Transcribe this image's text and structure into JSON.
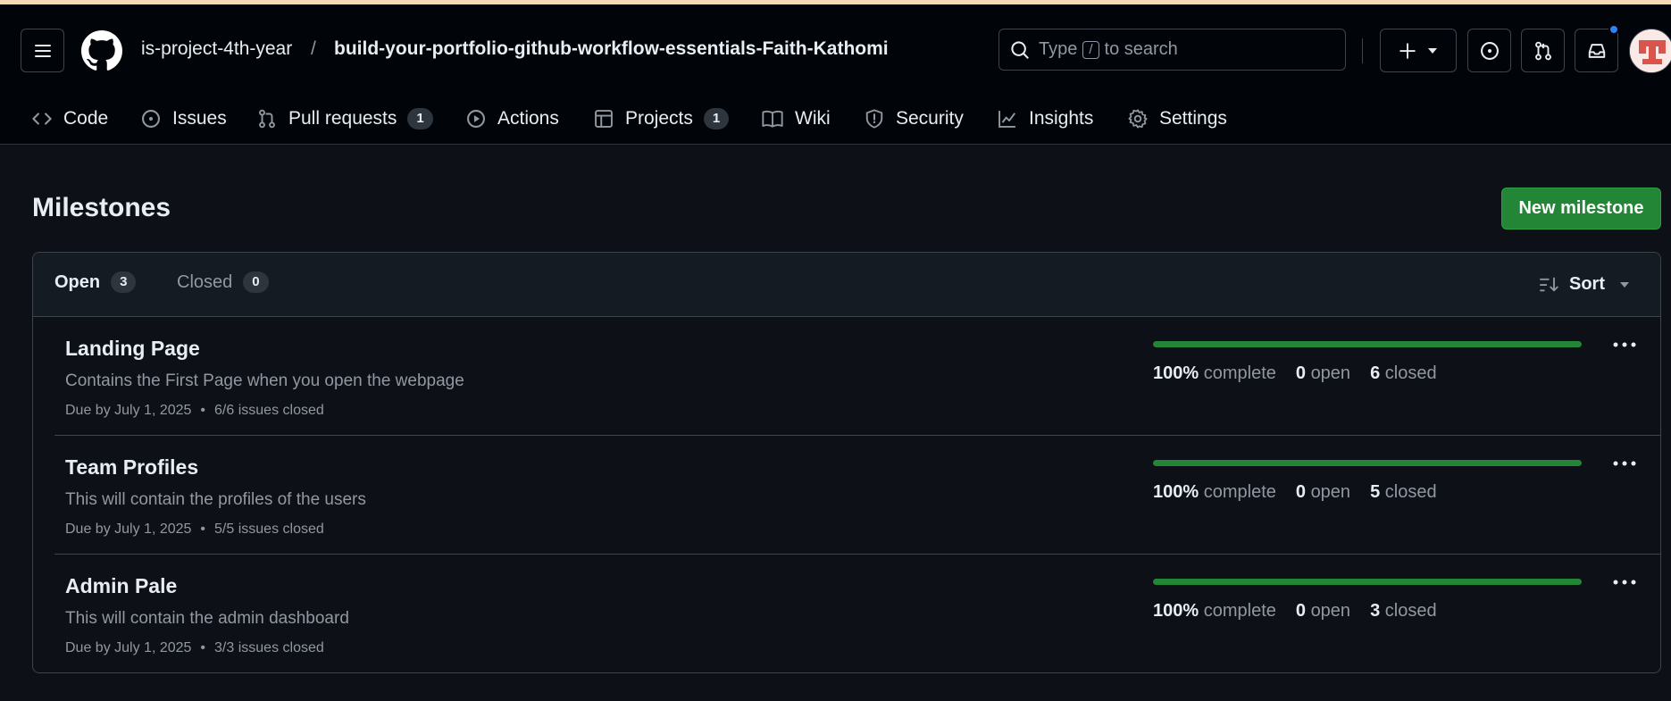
{
  "header": {
    "owner": "is-project-4th-year",
    "separator": "/",
    "repo": "build-your-portfolio-github-workflow-essentials-Faith-Kathomi",
    "search": {
      "prefix": "Type",
      "key": "/",
      "suffix": "to search"
    }
  },
  "nav": {
    "tabs": [
      {
        "label": "Code",
        "icon": "code-icon"
      },
      {
        "label": "Issues",
        "icon": "issue-icon"
      },
      {
        "label": "Pull requests",
        "icon": "pull-request-icon",
        "count": "1"
      },
      {
        "label": "Actions",
        "icon": "play-icon"
      },
      {
        "label": "Projects",
        "icon": "table-icon",
        "count": "1"
      },
      {
        "label": "Wiki",
        "icon": "book-icon"
      },
      {
        "label": "Security",
        "icon": "shield-icon"
      },
      {
        "label": "Insights",
        "icon": "graph-icon"
      },
      {
        "label": "Settings",
        "icon": "gear-icon"
      }
    ]
  },
  "page": {
    "title": "Milestones",
    "new_button": "New milestone"
  },
  "filters": {
    "open_label": "Open",
    "open_count": "3",
    "closed_label": "Closed",
    "closed_count": "0",
    "sort_label": "Sort"
  },
  "milestones": [
    {
      "title": "Landing Page",
      "description": "Contains the First Page when you open the webpage",
      "due": "Due by July 1, 2025",
      "issues": "6/6 issues closed",
      "progress": 1.0,
      "percent": "100%",
      "complete_label": "complete",
      "open_count": "0",
      "open_label": "open",
      "closed_count": "6",
      "closed_label": "closed"
    },
    {
      "title": "Team Profiles",
      "description": "This will contain the profiles of the users",
      "due": "Due by July 1, 2025",
      "issues": "5/5 issues closed",
      "progress": 1.0,
      "percent": "100%",
      "complete_label": "complete",
      "open_count": "0",
      "open_label": "open",
      "closed_count": "5",
      "closed_label": "closed"
    },
    {
      "title": "Admin Pale",
      "description": "This will contain the admin dashboard",
      "due": "Due by July 1, 2025",
      "issues": "3/3 issues closed",
      "progress": 1.0,
      "percent": "100%",
      "complete_label": "complete",
      "open_count": "0",
      "open_label": "open",
      "closed_count": "3",
      "closed_label": "closed"
    }
  ],
  "colors": {
    "background": "#0d1117",
    "header_bg": "#010409",
    "accent_green": "#238636",
    "notification_blue": "#2f81f7",
    "muted_text": "#9198a1"
  }
}
